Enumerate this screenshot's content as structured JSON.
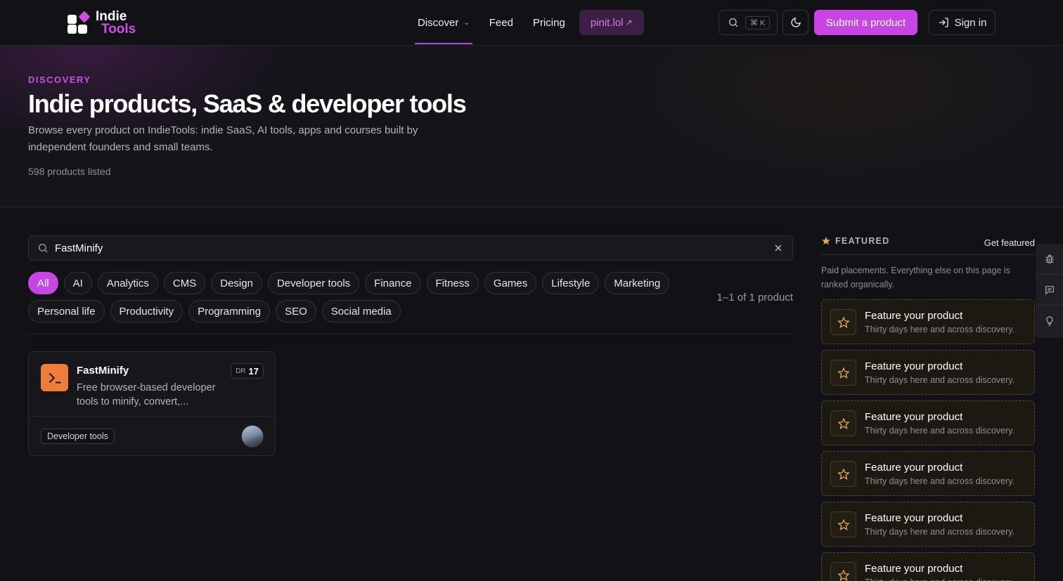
{
  "header": {
    "logo_line1": "Indie",
    "logo_line2": "Tools",
    "nav": {
      "discover": "Discover",
      "feed": "Feed",
      "pricing": "Pricing",
      "external": "pinit.lol"
    },
    "search_shortcut": "⌘ K",
    "submit_label": "Submit a product",
    "signin_label": "Sign in"
  },
  "hero": {
    "eyebrow": "DISCOVERY",
    "title": "Indie products, SaaS & developer tools",
    "description": "Browse every product on IndieTools: indie SaaS, AI tools, apps and courses built by independent founders and small teams.",
    "count": "598 products listed"
  },
  "search": {
    "value": "FastMinify"
  },
  "categories": [
    "All",
    "AI",
    "Analytics",
    "CMS",
    "Design",
    "Developer tools",
    "Finance",
    "Fitness",
    "Games",
    "Lifestyle",
    "Marketing",
    "Personal life",
    "Productivity",
    "Programming",
    "SEO",
    "Social media"
  ],
  "active_category": "All",
  "results_count": "1–1 of 1 product",
  "product": {
    "name": "FastMinify",
    "description": "Free browser-based developer tools to minify, convert,...",
    "dr_label": "DR",
    "dr_value": "17",
    "tag": "Developer tools"
  },
  "featured": {
    "title": "FEATURED",
    "link": "Get featured",
    "note": "Paid placements. Everything else on this page is ranked organically.",
    "slots": [
      {
        "title": "Feature your product",
        "subtitle": "Thirty days here and across discovery."
      },
      {
        "title": "Feature your product",
        "subtitle": "Thirty days here and across discovery."
      },
      {
        "title": "Feature your product",
        "subtitle": "Thirty days here and across discovery."
      },
      {
        "title": "Feature your product",
        "subtitle": "Thirty days here and across discovery."
      },
      {
        "title": "Feature your product",
        "subtitle": "Thirty days here and across discovery."
      },
      {
        "title": "Feature your product",
        "subtitle": "Thirty days here and across discovery."
      }
    ]
  },
  "colors": {
    "accent": "#c746e3",
    "background": "#111116",
    "product_icon": "#ee7d3a",
    "featured_star": "#e0a85a"
  }
}
